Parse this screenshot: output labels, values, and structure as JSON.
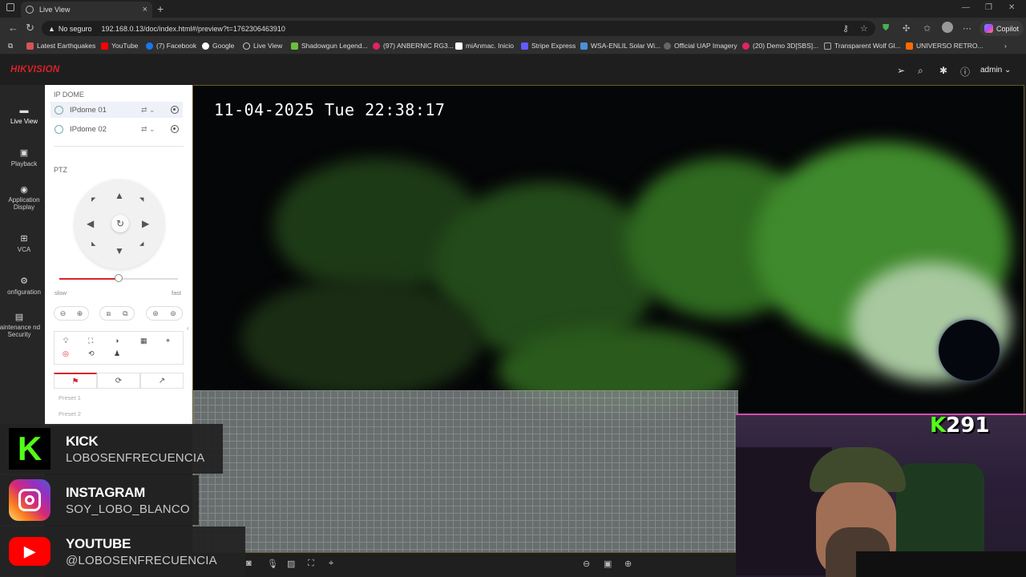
{
  "browser": {
    "tab_title": "Live View",
    "url_warning": "No seguro",
    "url": "192.168.0.13/doc/index.html#/preview?t=1762306463910",
    "copilot_label": "Copilot",
    "bookmarks": [
      "Latest Earthquakes",
      "YouTube",
      "(7) Facebook",
      "Google",
      "Live View",
      "Shadowgun Legend...",
      "(97) ANBERNIC RG3...",
      "miAnmac. Inicio",
      "Stripe Express",
      "WSA-ENLIL Solar Wi...",
      "Official UAP Imagery",
      "(20) Demo 3D[SBS]...",
      "Transparent Wolf Gl...",
      "UNIVERSO RETRO..."
    ]
  },
  "app": {
    "brand": "HIKVISION",
    "user": "admin",
    "nav": [
      {
        "label": "Live View",
        "icon": "live-view-icon"
      },
      {
        "label": "Playback",
        "icon": "playback-icon"
      },
      {
        "label": "Application Display",
        "icon": "application-icon"
      },
      {
        "label": "VCA",
        "icon": "vca-icon"
      },
      {
        "label": "onfiguration",
        "icon": "configuration-icon"
      },
      {
        "label": "laintenance nd Security",
        "icon": "maintenance-icon"
      }
    ],
    "panel": {
      "section_cameras": "IP DOME",
      "cameras": [
        "IPdome 01",
        "IPdome 02"
      ],
      "section_ptz": "PTZ",
      "speed_slow": "slow",
      "speed_fast": "fast",
      "speed_value": 0.5,
      "presets": [
        "Preset 1",
        "Preset 2"
      ]
    }
  },
  "video": {
    "timestamp": "11-04-2025  Tue 22:38:17"
  },
  "overlay": {
    "socials": [
      {
        "platform": "KICK",
        "handle": "LOBOSENFRECUENCIA",
        "color": "#53fc18"
      },
      {
        "platform": "INSTAGRAM",
        "handle": "SOY_LOBO_BLANCO",
        "color": "#e1306c"
      },
      {
        "platform": "YOUTUBE",
        "handle": "@LOBOSENFRECUENCIA",
        "color": "#ff0000"
      }
    ],
    "kick_viewers_letter": "K",
    "kick_viewers": "291"
  }
}
